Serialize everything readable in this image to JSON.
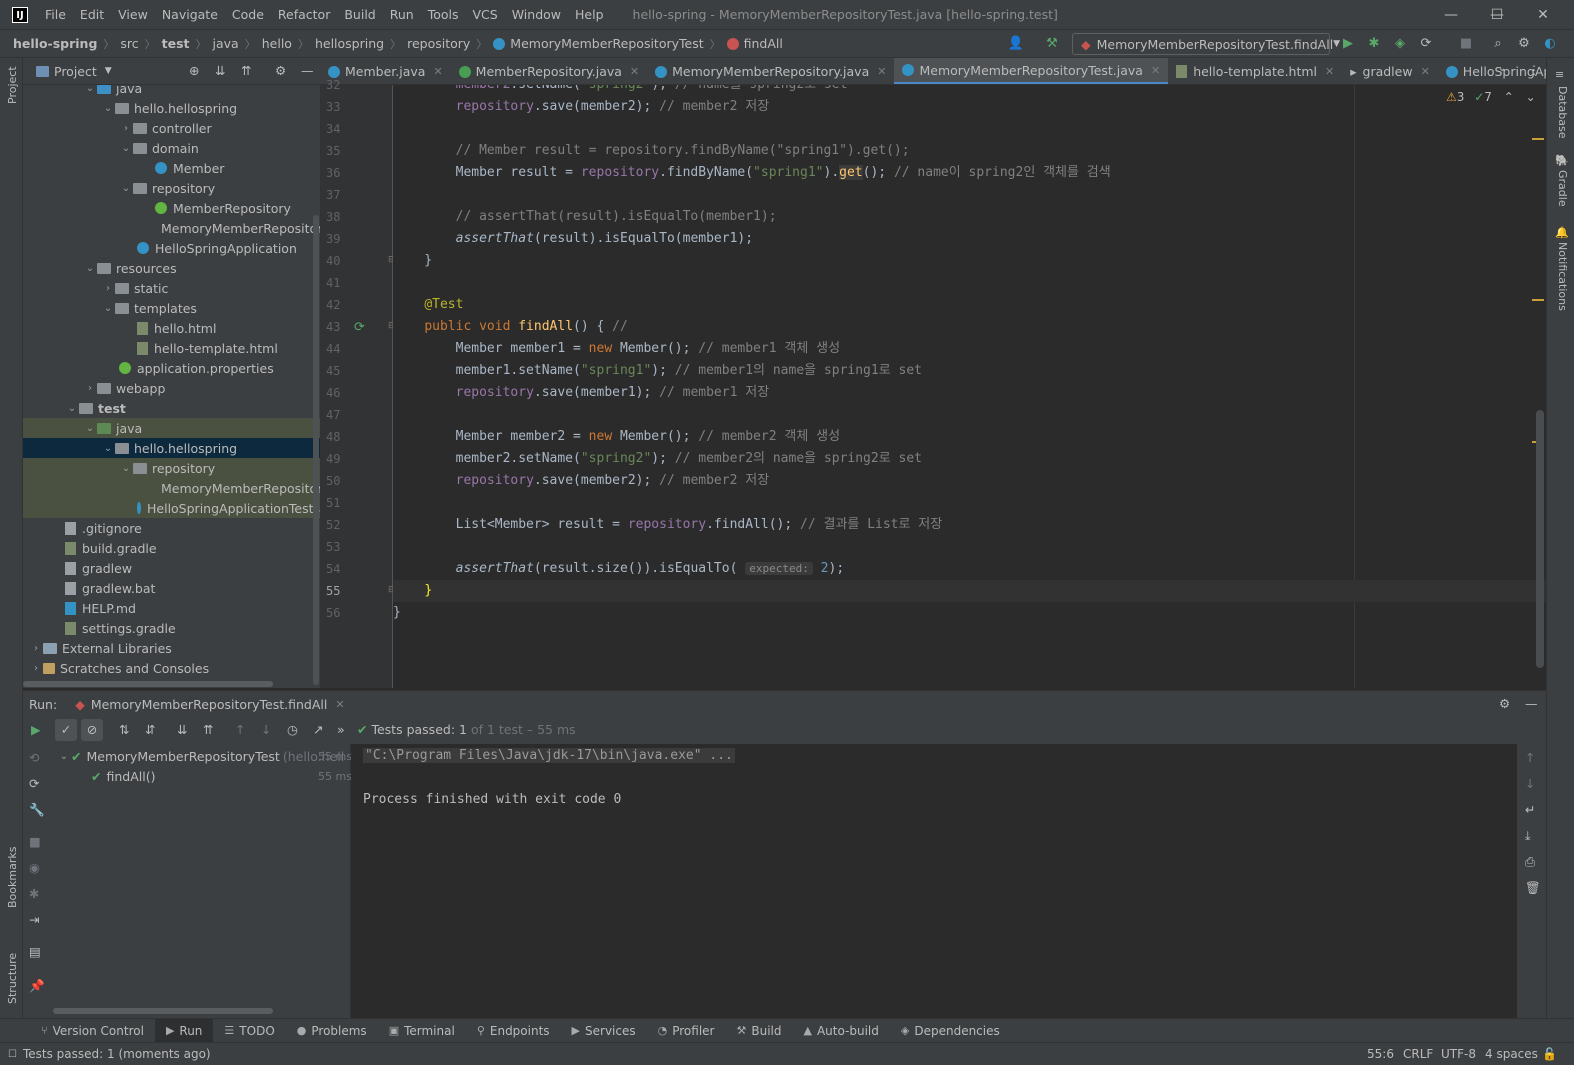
{
  "titlebar": {
    "menus": [
      "File",
      "Edit",
      "View",
      "Navigate",
      "Code",
      "Refactor",
      "Build",
      "Run",
      "Tools",
      "VCS",
      "Window",
      "Help"
    ],
    "title": "hello-spring - MemoryMemberRepositoryTest.java [hello-spring.test]"
  },
  "breadcrumb": {
    "items": [
      "hello-spring",
      "src",
      "test",
      "java",
      "hello",
      "hellospring",
      "repository",
      "MemoryMemberRepositoryTest",
      "findAll"
    ]
  },
  "run_config": "MemoryMemberRepositoryTest.findAll",
  "left_stripe": {
    "project": "Project",
    "bookmarks": "Bookmarks",
    "structure": "Structure"
  },
  "right_stripe": {
    "database": "Database",
    "gradle": "Gradle",
    "notifications": "Notifications"
  },
  "project_panel": {
    "title": "Project",
    "tree": [
      {
        "label": "java",
        "kind": "folder-blue"
      },
      {
        "label": "hello.hellospring",
        "kind": "pkg"
      },
      {
        "label": "controller",
        "kind": "pkg"
      },
      {
        "label": "domain",
        "kind": "pkg"
      },
      {
        "label": "Member",
        "kind": "class"
      },
      {
        "label": "repository",
        "kind": "pkg"
      },
      {
        "label": "MemberRepository",
        "kind": "interface"
      },
      {
        "label": "MemoryMemberRepository",
        "kind": "class"
      },
      {
        "label": "HelloSpringApplication",
        "kind": "class"
      },
      {
        "label": "resources",
        "kind": "folder"
      },
      {
        "label": "static",
        "kind": "folder"
      },
      {
        "label": "templates",
        "kind": "folder"
      },
      {
        "label": "hello.html",
        "kind": "html"
      },
      {
        "label": "hello-template.html",
        "kind": "html"
      },
      {
        "label": "application.properties",
        "kind": "props"
      },
      {
        "label": "webapp",
        "kind": "folder"
      },
      {
        "label": "test",
        "kind": "folder"
      },
      {
        "label": "java",
        "kind": "folder-green"
      },
      {
        "label": "hello.hellospring",
        "kind": "pkg"
      },
      {
        "label": "repository",
        "kind": "pkg"
      },
      {
        "label": "MemoryMemberRepositoryTest",
        "kind": "class"
      },
      {
        "label": "HelloSpringApplicationTests",
        "kind": "class"
      },
      {
        "label": ".gitignore",
        "kind": "file"
      },
      {
        "label": "build.gradle",
        "kind": "gradle"
      },
      {
        "label": "gradlew",
        "kind": "file"
      },
      {
        "label": "gradlew.bat",
        "kind": "file"
      },
      {
        "label": "HELP.md",
        "kind": "md"
      },
      {
        "label": "settings.gradle",
        "kind": "gradle"
      },
      {
        "label": "External Libraries",
        "kind": "lib"
      },
      {
        "label": "Scratches and Consoles",
        "kind": "scratch"
      }
    ]
  },
  "tabs": [
    "Member.java",
    "MemberRepository.java",
    "MemoryMemberRepository.java",
    "MemoryMemberRepositoryTest.java",
    "hello-template.html",
    "gradlew",
    "HelloSpringApplication.java"
  ],
  "inspections": {
    "warnings": "3",
    "weak_warnings": "7"
  },
  "editor": {
    "line_numbers": [
      "32",
      "33",
      "34",
      "35",
      "36",
      "37",
      "38",
      "39",
      "40",
      "41",
      "42",
      "43",
      "44",
      "45",
      "46",
      "47",
      "48",
      "49",
      "50",
      "51",
      "52",
      "53",
      "54",
      "55",
      "56"
    ],
    "hint_expected": "expected:"
  },
  "run": {
    "label": "Run:",
    "tab": "MemoryMemberRepositoryTest.findAll",
    "tests_passed_label": "Tests passed:",
    "tests_passed_count": "1",
    "tests_passed_of": "of 1 test – 55 ms",
    "tree": [
      {
        "name": "MemoryMemberRepositoryTest",
        "pkg": "(hello.hell",
        "time": "55 ms"
      },
      {
        "name": "findAll()",
        "time": "55 ms"
      }
    ],
    "console": [
      "\"C:\\Program Files\\Java\\jdk-17\\bin\\java.exe\" ...",
      "",
      "Process finished with exit code 0"
    ]
  },
  "tool_tabs": [
    "Version Control",
    "Run",
    "TODO",
    "Problems",
    "Terminal",
    "Endpoints",
    "Services",
    "Profiler",
    "Build",
    "Auto-build",
    "Dependencies"
  ],
  "status": {
    "message": "Tests passed: 1 (moments ago)",
    "position": "55:6",
    "line_sep": "CRLF",
    "encoding": "UTF-8",
    "indent": "4 spaces"
  }
}
